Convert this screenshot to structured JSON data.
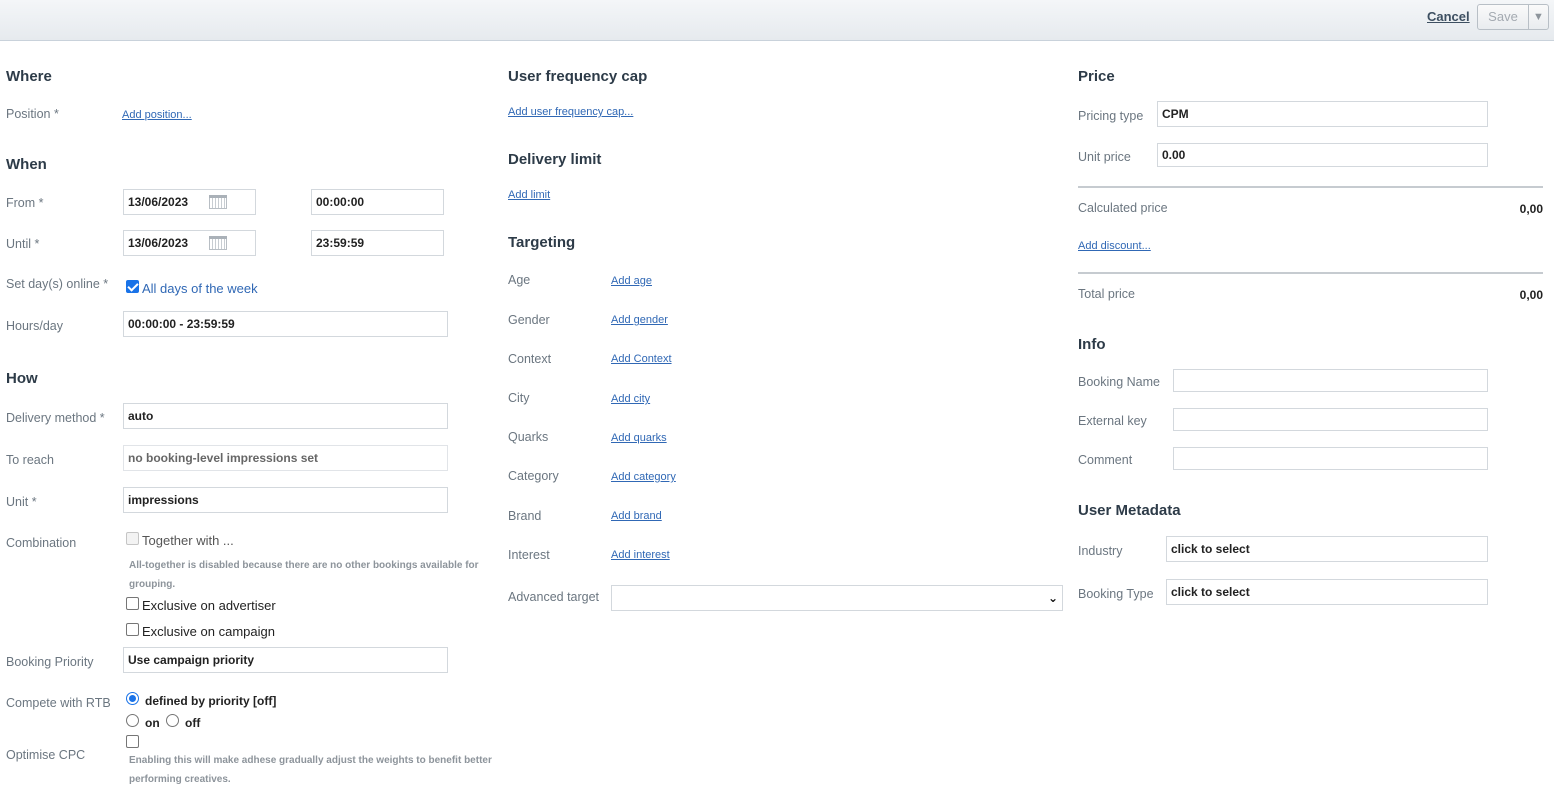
{
  "header": {
    "cancel_label": "Cancel",
    "save_label": "Save",
    "save_caret": "▼"
  },
  "where": {
    "title": "Where",
    "position_label": "Position *",
    "position_link": "Add position..."
  },
  "when": {
    "title": "When",
    "from_label": "From *",
    "from_date": "13/06/2023",
    "from_time": "00:00:00",
    "until_label": "Until *",
    "until_date": "13/06/2023",
    "until_time": "23:59:59",
    "days_label": "Set day(s) online *",
    "days_option": "All days of the week",
    "days_checked": true,
    "hours_label": "Hours/day",
    "hours_value": "00:00:00 - 23:59:59"
  },
  "how": {
    "title": "How",
    "delivery_label": "Delivery method *",
    "delivery_value": "auto",
    "reach_label": "To reach",
    "reach_value": "no booking-level impressions set",
    "unit_label": "Unit *",
    "unit_value": "impressions",
    "combination_label": "Combination",
    "together_label": "Together with ...",
    "together_hint": "All-together is disabled because there are no other bookings available for grouping.",
    "exclusive_advertiser_label": "Exclusive on advertiser",
    "exclusive_campaign_label": "Exclusive on campaign",
    "priority_label": "Booking Priority",
    "priority_value": "Use campaign priority",
    "rtb_label": "Compete with RTB",
    "rtb_defined": "defined by priority [off]",
    "rtb_on": "on",
    "rtb_off": "off",
    "cpc_label": "Optimise CPC",
    "cpc_hint": "Enabling this will make adhese gradually adjust the weights to benefit better performing creatives."
  },
  "frequency": {
    "title": "User frequency cap",
    "link": "Add user frequency cap..."
  },
  "delivery_limit": {
    "title": "Delivery limit",
    "link": "Add limit"
  },
  "targeting": {
    "title": "Targeting",
    "rows": [
      {
        "label": "Age",
        "link": "Add age"
      },
      {
        "label": "Gender",
        "link": "Add gender"
      },
      {
        "label": "Context",
        "link": "Add Context"
      },
      {
        "label": "City",
        "link": "Add city"
      },
      {
        "label": "Quarks",
        "link": "Add quarks"
      },
      {
        "label": "Category",
        "link": "Add category"
      },
      {
        "label": "Brand",
        "link": "Add brand"
      },
      {
        "label": "Interest",
        "link": "Add interest"
      }
    ],
    "advanced_label": "Advanced target",
    "advanced_value": ""
  },
  "price": {
    "title": "Price",
    "pricing_type_label": "Pricing type",
    "pricing_type_value": "CPM",
    "unit_price_label": "Unit price",
    "unit_price_value": "0.00",
    "calculated_label": "Calculated price",
    "calculated_value": "0,00",
    "discount_link": "Add discount...",
    "total_label": "Total price",
    "total_value": "0,00"
  },
  "info": {
    "title": "Info",
    "booking_name_label": "Booking Name",
    "booking_name_value": "",
    "external_key_label": "External key",
    "external_key_value": "",
    "comment_label": "Comment",
    "comment_value": ""
  },
  "metadata": {
    "title": "User Metadata",
    "industry_label": "Industry",
    "industry_value": "click to select",
    "booking_type_label": "Booking Type",
    "booking_type_value": "click to select"
  }
}
